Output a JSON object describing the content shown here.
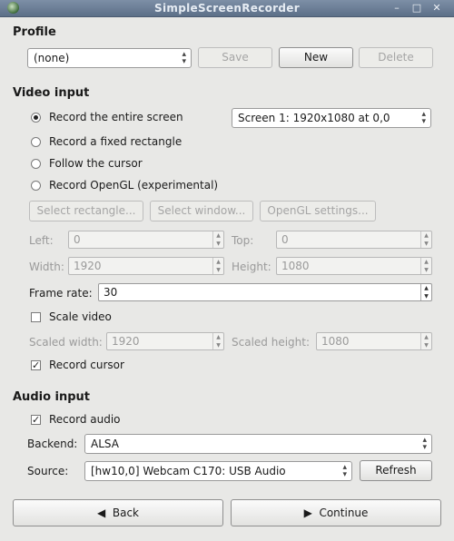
{
  "window": {
    "title": "SimpleScreenRecorder",
    "minimize": "–",
    "maximize": "□",
    "close": "✕"
  },
  "profile": {
    "heading": "Profile",
    "selected": "(none)",
    "save": "Save",
    "new": "New",
    "delete": "Delete"
  },
  "video": {
    "heading": "Video input",
    "options": [
      "Record the entire screen",
      "Record a fixed rectangle",
      "Follow the cursor",
      "Record OpenGL (experimental)"
    ],
    "selected_index": 0,
    "screen_select": "Screen 1: 1920x1080 at 0,0",
    "select_rectangle": "Select rectangle...",
    "select_window": "Select window...",
    "opengl_settings": "OpenGL settings...",
    "left_label": "Left:",
    "left_value": "0",
    "top_label": "Top:",
    "top_value": "0",
    "width_label": "Width:",
    "width_value": "1920",
    "height_label": "Height:",
    "height_value": "1080",
    "frame_rate_label": "Frame rate:",
    "frame_rate_value": "30",
    "scale_video": "Scale video",
    "scale_video_checked": false,
    "scaled_width_label": "Scaled width:",
    "scaled_width_value": "1920",
    "scaled_height_label": "Scaled height:",
    "scaled_height_value": "1080",
    "record_cursor": "Record cursor",
    "record_cursor_checked": true
  },
  "audio": {
    "heading": "Audio input",
    "record_audio": "Record audio",
    "record_audio_checked": true,
    "backend_label": "Backend:",
    "backend_value": "ALSA",
    "source_label": "Source:",
    "source_value": "[hw10,0] Webcam C170: USB Audio",
    "refresh": "Refresh"
  },
  "footer": {
    "back": "Back",
    "continue": "Continue"
  }
}
